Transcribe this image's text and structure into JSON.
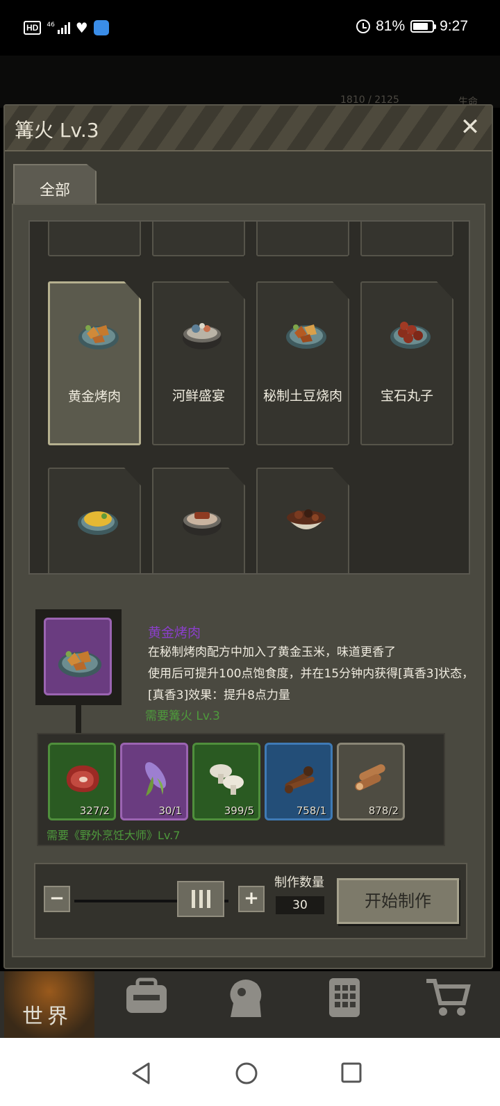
{
  "status_bar": {
    "hd": "HD",
    "network": "46",
    "battery_percent": "81%",
    "time": "9:27",
    "battery_level": 0.81
  },
  "background": {
    "hp_text": "1810 / 2125",
    "hp_label": "生命"
  },
  "panel": {
    "title": "篝火 Lv.3",
    "close_icon": "close-icon",
    "tabs": [
      {
        "label": "全部",
        "active": true
      }
    ]
  },
  "recipes": [
    {
      "name": "黄金烤肉",
      "icon": "golden-roast-meat-dish",
      "selected": true
    },
    {
      "name": "河鲜盛宴",
      "icon": "river-seafood-feast-pot",
      "selected": false
    },
    {
      "name": "秘制土豆烧肉",
      "icon": "potato-braised-meat-dish",
      "selected": false
    },
    {
      "name": "宝石丸子",
      "icon": "meatball-dish",
      "selected": false
    },
    {
      "name": "",
      "icon": "omelette-dish",
      "selected": false
    },
    {
      "name": "",
      "icon": "meat-stew-pot",
      "selected": false
    },
    {
      "name": "",
      "icon": "mushroom-bowl",
      "selected": false
    }
  ],
  "detail": {
    "name": "黄金烤肉",
    "desc_line1": "在秘制烤肉配方中加入了黄金玉米，味道更香了",
    "desc_line2": "使用后可提升100点饱食度，并在15分钟内获得[真香3]状态，",
    "desc_line3": "[真香3]效果：提升8点力量",
    "requirement": "需要篝火 Lv.3"
  },
  "materials": {
    "items": [
      {
        "icon": "steak-icon",
        "count": "327/2",
        "rarity": "green"
      },
      {
        "icon": "corn-icon",
        "count": "30/1",
        "rarity": "purple"
      },
      {
        "icon": "mushroom-icon",
        "count": "399/5",
        "rarity": "green"
      },
      {
        "icon": "spices-icon",
        "count": "758/1",
        "rarity": "blue"
      },
      {
        "icon": "firewood-icon",
        "count": "878/2",
        "rarity": "gray"
      }
    ],
    "skill_requirement": "需要《野外烹饪大师》Lv.7"
  },
  "craft": {
    "minus": "−",
    "plus": "+",
    "quantity_label": "制作数量",
    "quantity": "30",
    "start_label": "开始制作"
  },
  "bottom_nav": {
    "world_label": "世界",
    "icons": [
      "backpack-icon",
      "skills-head-icon",
      "phone-icon",
      "shop-cart-icon"
    ]
  },
  "colors": {
    "panel_bg": "#393830",
    "selected_card": "#5b5a4d",
    "purple_rarity": "#6a3c80",
    "green_rarity": "#2a5a22",
    "blue_rarity": "#234e78",
    "requirement_green": "#4e9a3c",
    "item_name_purple": "#8a3fc9"
  }
}
